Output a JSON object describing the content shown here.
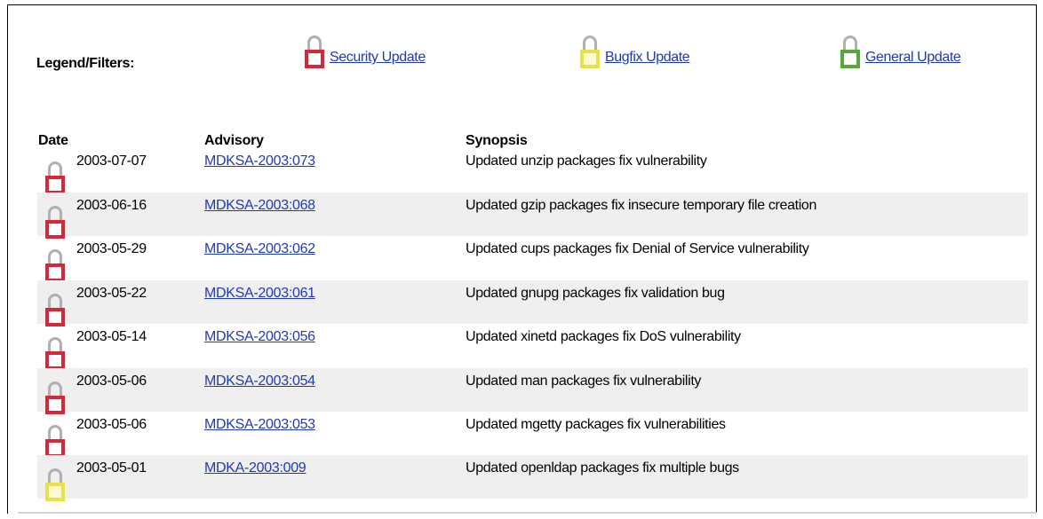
{
  "legend": {
    "label": "Legend/Filters:",
    "filters": [
      {
        "label": "Security Update",
        "icon": "red-lock-icon",
        "color": "#d9263a"
      },
      {
        "label": "Bugfix Update",
        "icon": "yellow-lock-icon",
        "color": "#e8e14a"
      },
      {
        "label": "General Update",
        "icon": "green-lock-icon",
        "color": "#55a83a"
      }
    ]
  },
  "table": {
    "headers": {
      "date": "Date",
      "advisory": "Advisory",
      "synopsis": "Synopsis"
    },
    "rows": [
      {
        "type": "security",
        "date": "2003-07-07",
        "advisory": "MDKSA-2003:073",
        "synopsis": "Updated unzip packages fix vulnerability"
      },
      {
        "type": "security",
        "date": "2003-06-16",
        "advisory": "MDKSA-2003:068",
        "synopsis": "Updated gzip packages fix insecure temporary file creation"
      },
      {
        "type": "security",
        "date": "2003-05-29",
        "advisory": "MDKSA-2003:062",
        "synopsis": "Updated cups packages fix Denial of Service vulnerability"
      },
      {
        "type": "security",
        "date": "2003-05-22",
        "advisory": "MDKSA-2003:061",
        "synopsis": "Updated gnupg packages fix validation bug"
      },
      {
        "type": "security",
        "date": "2003-05-14",
        "advisory": "MDKSA-2003:056",
        "synopsis": "Updated xinetd packages fix DoS vulnerability"
      },
      {
        "type": "security",
        "date": "2003-05-06",
        "advisory": "MDKSA-2003:054",
        "synopsis": "Updated man packages fix vulnerability"
      },
      {
        "type": "security",
        "date": "2003-05-06",
        "advisory": "MDKSA-2003:053",
        "synopsis": "Updated mgetty packages fix vulnerabilities"
      },
      {
        "type": "bugfix",
        "date": "2003-05-01",
        "advisory": "MDKA-2003:009",
        "synopsis": "Updated openldap packages fix multiple bugs"
      }
    ]
  }
}
